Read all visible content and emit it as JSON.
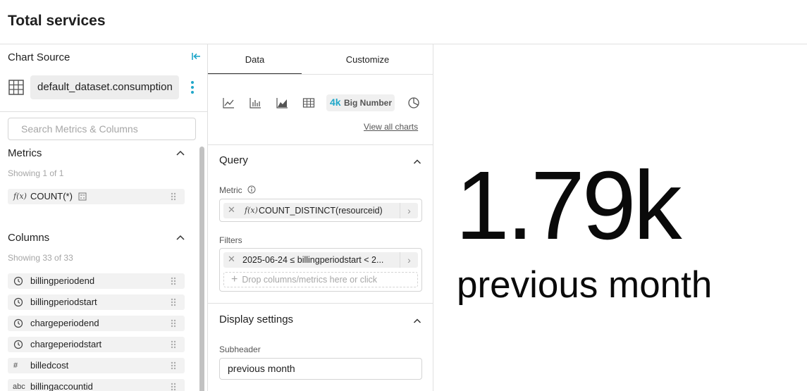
{
  "header": {
    "title": "Total services"
  },
  "chart_source": {
    "title": "Chart Source",
    "dataset": "default_dataset.consumption"
  },
  "search": {
    "placeholder": "Search Metrics & Columns"
  },
  "metrics": {
    "title": "Metrics",
    "showing": "Showing 1 of 1",
    "items": [
      {
        "icon": "function-icon",
        "label": "COUNT(*)"
      }
    ]
  },
  "columns": {
    "title": "Columns",
    "showing": "Showing 33 of 33",
    "items": [
      {
        "icon": "clock-icon",
        "label": "billingperiodend"
      },
      {
        "icon": "clock-icon",
        "label": "billingperiodstart"
      },
      {
        "icon": "clock-icon",
        "label": "chargeperiodend"
      },
      {
        "icon": "clock-icon",
        "label": "chargeperiodstart"
      },
      {
        "icon": "hash-icon",
        "glyph": "#",
        "label": "billedcost"
      },
      {
        "icon": "abc-icon",
        "glyph": "abc",
        "label": "billingaccountid"
      }
    ]
  },
  "tabs": {
    "data": "Data",
    "customize": "Customize"
  },
  "chart_types": {
    "selected_prefix": "4k",
    "selected_label": "Big Number",
    "view_all": "View all charts"
  },
  "query": {
    "title": "Query",
    "metric_label": "Metric",
    "metric_value": "COUNT_DISTINCT(resourceid)",
    "filters_label": "Filters",
    "filter_value": "2025-06-24 ≤ billingperiodstart < 2...",
    "drop_placeholder": "Drop columns/metrics here or click"
  },
  "display": {
    "title": "Display settings",
    "subheader_label": "Subheader",
    "subheader_value": "previous month"
  },
  "big_number": {
    "value": "1.79k",
    "subheader": "previous month"
  },
  "colors": {
    "accent": "#20a7c9",
    "text": "#1f1f1f",
    "muted": "#a6a6a6"
  }
}
